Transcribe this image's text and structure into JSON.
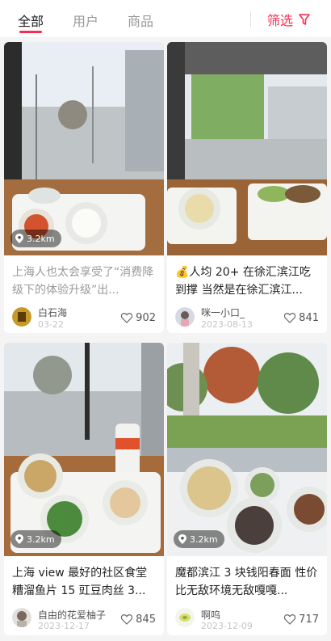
{
  "tabs": [
    {
      "label": "全部"
    },
    {
      "label": "用户"
    },
    {
      "label": "商品"
    }
  ],
  "filter": {
    "label": "筛选",
    "icon": "filter-icon"
  },
  "accent_color": "#ff2a4f",
  "posts": [
    {
      "distance": "3.2km",
      "title": "上海人也太会享受了“消费降级下的体验升级”出...",
      "author": "白石海",
      "date": "03-22",
      "likes": "902"
    },
    {
      "distance": "",
      "title": "💰人均 20+ 在徐汇滨江吃到撑 当然是在徐汇滨江...",
      "author": "咪一小口_",
      "date": "2023-08-13",
      "likes": "841"
    },
    {
      "distance": "3.2km",
      "title": "上海 view 最好的社区食堂 糟溜鱼片 15 豇豆肉丝 3...",
      "author": "自由的花爱柚子",
      "date": "2023-12-17",
      "likes": "845"
    },
    {
      "distance": "3.2km",
      "title": "魔都滨江 3 块钱阳春面 性价比无敌环境无敌嘎嘎...",
      "author": "啊呜",
      "date": "2023-12-09",
      "likes": "717"
    }
  ]
}
